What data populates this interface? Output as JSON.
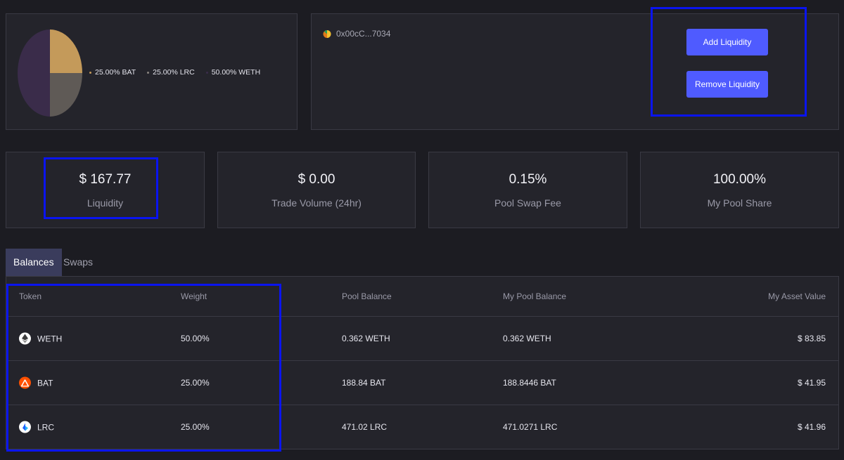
{
  "pie": {
    "slices": [
      {
        "label": "25.00% BAT",
        "value": 25,
        "color": "#c49a5a"
      },
      {
        "label": "25.00% LRC",
        "value": 25,
        "color": "#5f5a56"
      },
      {
        "label": "50.00% WETH",
        "value": 50,
        "color": "#3a2c4a"
      }
    ]
  },
  "pool": {
    "address": "0x00cC...7034",
    "add_label": "Add Liquidity",
    "remove_label": "Remove Liquidity"
  },
  "stats": [
    {
      "value": "$ 167.77",
      "label": "Liquidity"
    },
    {
      "value": "$ 0.00",
      "label": "Trade Volume (24hr)"
    },
    {
      "value": "0.15%",
      "label": "Pool Swap Fee"
    },
    {
      "value": "100.00%",
      "label": "My Pool Share"
    }
  ],
  "tabs": [
    "Balances",
    "Swaps"
  ],
  "table": {
    "headers": [
      "Token",
      "Weight",
      "Pool Balance",
      "My Pool Balance",
      "My Asset Value"
    ],
    "rows": [
      {
        "token": "WETH",
        "icon": "weth-icon",
        "weight": "50.00%",
        "pool_balance": "0.362 WETH",
        "my_pool_balance": "0.362 WETH",
        "my_asset_value": "$ 83.85"
      },
      {
        "token": "BAT",
        "icon": "bat-icon",
        "weight": "25.00%",
        "pool_balance": "188.84 BAT",
        "my_pool_balance": "188.8446 BAT",
        "my_asset_value": "$ 41.95"
      },
      {
        "token": "LRC",
        "icon": "lrc-icon",
        "weight": "25.00%",
        "pool_balance": "471.02 LRC",
        "my_pool_balance": "471.0271 LRC",
        "my_asset_value": "$ 41.96"
      }
    ]
  },
  "colors": {
    "accent": "#4f5bff",
    "highlight": "#0a14f0"
  }
}
